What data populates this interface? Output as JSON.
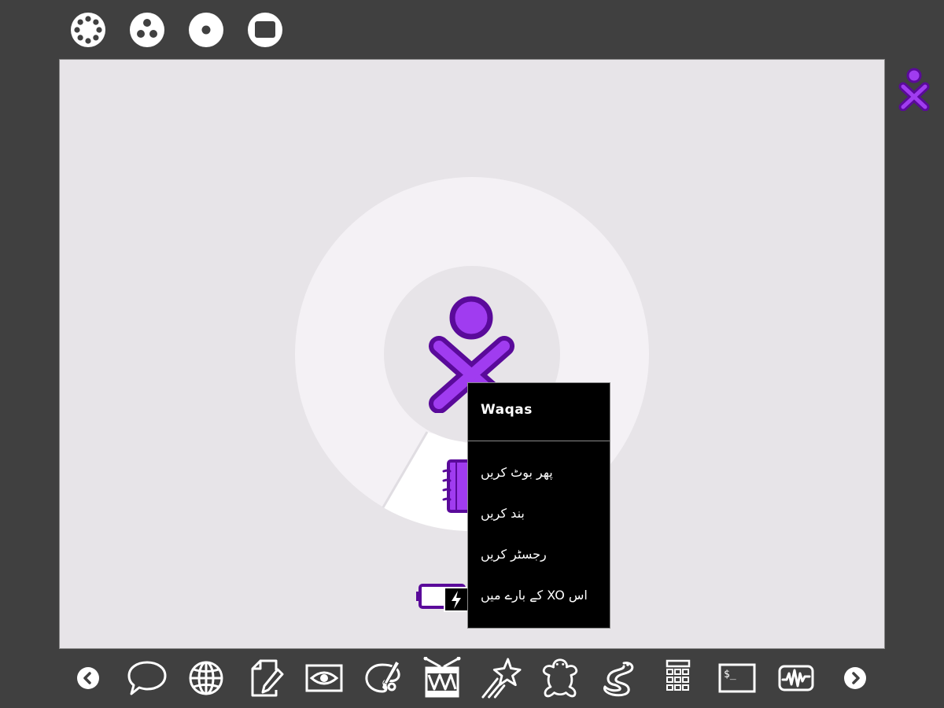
{
  "colors": {
    "frame_background": "#404040",
    "canvas_background": "#e7e4e8",
    "ring_color": "#f4f1f5",
    "highlight_segment": "#ffffff",
    "buddy_fill": "#a03cf0",
    "buddy_stroke": "#5a0a9a",
    "palette_background": "#000000",
    "palette_text": "#ffffff",
    "icon_color": "#ffffff"
  },
  "zoom_toolbar": {
    "items": [
      {
        "name": "neighborhood-view",
        "icon": "neighborhood-icon"
      },
      {
        "name": "group-view",
        "icon": "group-icon"
      },
      {
        "name": "home-view",
        "icon": "home-icon"
      },
      {
        "name": "activity-view",
        "icon": "activity-window-icon"
      }
    ]
  },
  "home": {
    "buddy_icon": "xo-buddy-icon",
    "journal_icon": "journal-icon",
    "battery_icon": "battery-charging-icon"
  },
  "palette": {
    "title": "Waqas",
    "items": [
      {
        "label": "پھر بوٹ کریں"
      },
      {
        "label": "بند کریں"
      },
      {
        "label": "رجسٹر کریں"
      },
      {
        "label": "اس XO کے بارے میں"
      }
    ]
  },
  "activity_bar": {
    "items": [
      {
        "name": "scroll-left",
        "icon": "chevron-left-icon"
      },
      {
        "name": "chat",
        "icon": "chat-bubble-icon"
      },
      {
        "name": "browse",
        "icon": "globe-icon"
      },
      {
        "name": "write",
        "icon": "write-document-icon"
      },
      {
        "name": "record",
        "icon": "eye-icon"
      },
      {
        "name": "paint",
        "icon": "paint-palette-icon"
      },
      {
        "name": "tamtam",
        "icon": "drum-icon"
      },
      {
        "name": "etoys",
        "icon": "shooting-star-icon"
      },
      {
        "name": "turtle",
        "icon": "turtle-icon"
      },
      {
        "name": "pippy",
        "icon": "snake-icon"
      },
      {
        "name": "calculate",
        "icon": "calculator-icon"
      },
      {
        "name": "terminal",
        "icon": "terminal-icon"
      },
      {
        "name": "measure",
        "icon": "waveform-icon"
      },
      {
        "name": "scroll-right",
        "icon": "chevron-right-icon"
      }
    ]
  }
}
